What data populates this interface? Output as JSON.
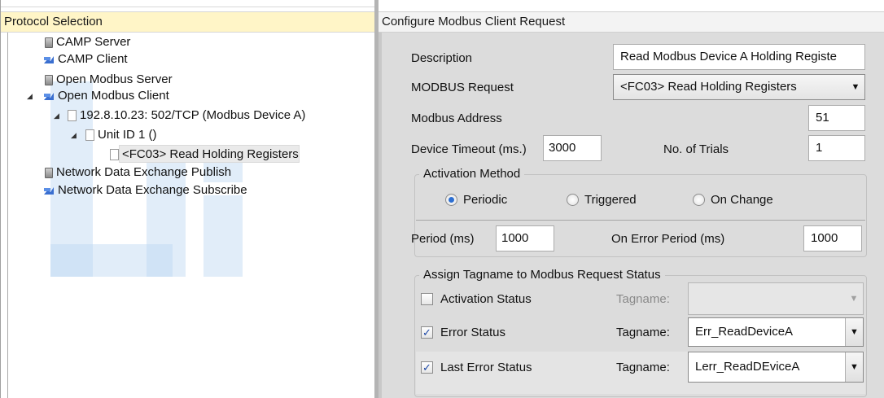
{
  "left": {
    "header": "Protocol Selection",
    "tree": [
      {
        "label": "CAMP Server",
        "icon": "server-icon"
      },
      {
        "label": "CAMP Client",
        "icon": "client-icon"
      },
      {
        "label": "Open Modbus Server",
        "icon": "server-icon"
      },
      {
        "label": "Open Modbus Client",
        "icon": "client-icon",
        "expanded": true
      },
      {
        "label": "192.8.10.23: 502/TCP (Modbus Device A)",
        "icon": "document-icon",
        "expanded": true
      },
      {
        "label": "Unit ID 1 ()",
        "icon": "document-icon",
        "expanded": true
      },
      {
        "label": "<FC03> Read Holding Registers",
        "icon": "document-icon",
        "selected": true
      },
      {
        "label": "Network Data Exchange Publish",
        "icon": "server-icon"
      },
      {
        "label": "Network Data Exchange Subscribe",
        "icon": "client-icon"
      }
    ]
  },
  "right": {
    "header": "Configure Modbus Client Request",
    "description_label": "Description",
    "description_value": "Read Modbus Device A Holding Registe",
    "modbus_request_label": "MODBUS Request",
    "modbus_request_value": "<FC03> Read Holding Registers",
    "modbus_address_label": "Modbus Address",
    "modbus_address_value": "51",
    "device_timeout_label": "Device Timeout (ms.)",
    "device_timeout_value": "3000",
    "trials_label": "No. of Trials",
    "trials_value": "1",
    "activation": {
      "title": "Activation Method",
      "options": [
        "Periodic",
        "Triggered",
        "On Change"
      ],
      "selected": "Periodic",
      "period_label": "Period (ms)",
      "period_value": "1000",
      "on_error_label": "On Error Period (ms)",
      "on_error_value": "1000"
    },
    "assign": {
      "title": "Assign Tagname to Modbus Request Status",
      "tagname_label": "Tagname:",
      "rows": [
        {
          "label": "Activation Status",
          "checked": false,
          "tagname": ""
        },
        {
          "label": "Error Status",
          "checked": true,
          "tagname": "Err_ReadDeviceA"
        },
        {
          "label": "Last Error Status",
          "checked": true,
          "tagname": "Lerr_ReadDEviceA"
        }
      ]
    }
  },
  "colors": {
    "header_highlight": "#fff5c7",
    "radio_selected": "#2d6fd1",
    "checkmark": "#1c47a6"
  }
}
